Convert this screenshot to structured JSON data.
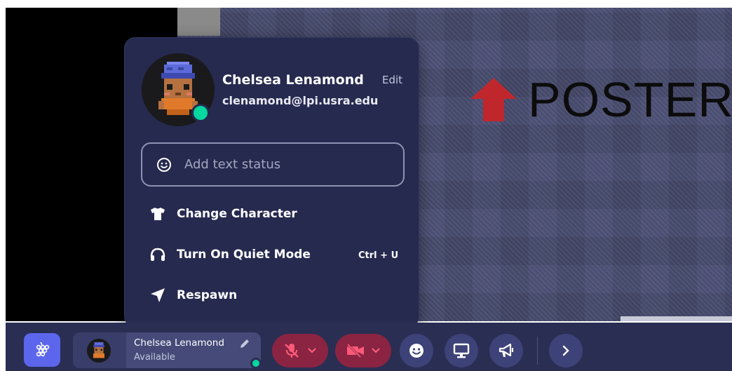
{
  "game": {
    "poster_text": "POSTER",
    "poster_arrow_icon": "red-up-arrow"
  },
  "popover": {
    "name": "Chelsea Lenamond",
    "edit_label": "Edit",
    "email": "clenamond@lpi.usra.edu",
    "status_placeholder": "Add text status",
    "status_color": "#06d6a0",
    "menu": [
      {
        "label": "Change Character",
        "icon": "shirt-icon"
      },
      {
        "label": "Turn On Quiet Mode",
        "icon": "headphones-icon",
        "shortcut": "Ctrl + U"
      },
      {
        "label": "Respawn",
        "icon": "navigation-arrow-icon"
      }
    ]
  },
  "bottom_bar": {
    "profile": {
      "name": "Chelsea Lenamond",
      "status": "Available"
    },
    "buttons": [
      {
        "name": "menu-grid",
        "icon": "grapes-grid-icon"
      },
      {
        "name": "microphone",
        "icon": "microphone-off-icon",
        "state": "off"
      },
      {
        "name": "camera",
        "icon": "camera-off-icon",
        "state": "off"
      },
      {
        "name": "emote",
        "icon": "smiley-icon"
      },
      {
        "name": "screen-share",
        "icon": "monitor-icon"
      },
      {
        "name": "announce",
        "icon": "megaphone-icon"
      },
      {
        "name": "expand",
        "icon": "chevron-right-icon"
      }
    ],
    "accent_color": "#5b66ec",
    "muted_color": "#8a2442"
  }
}
